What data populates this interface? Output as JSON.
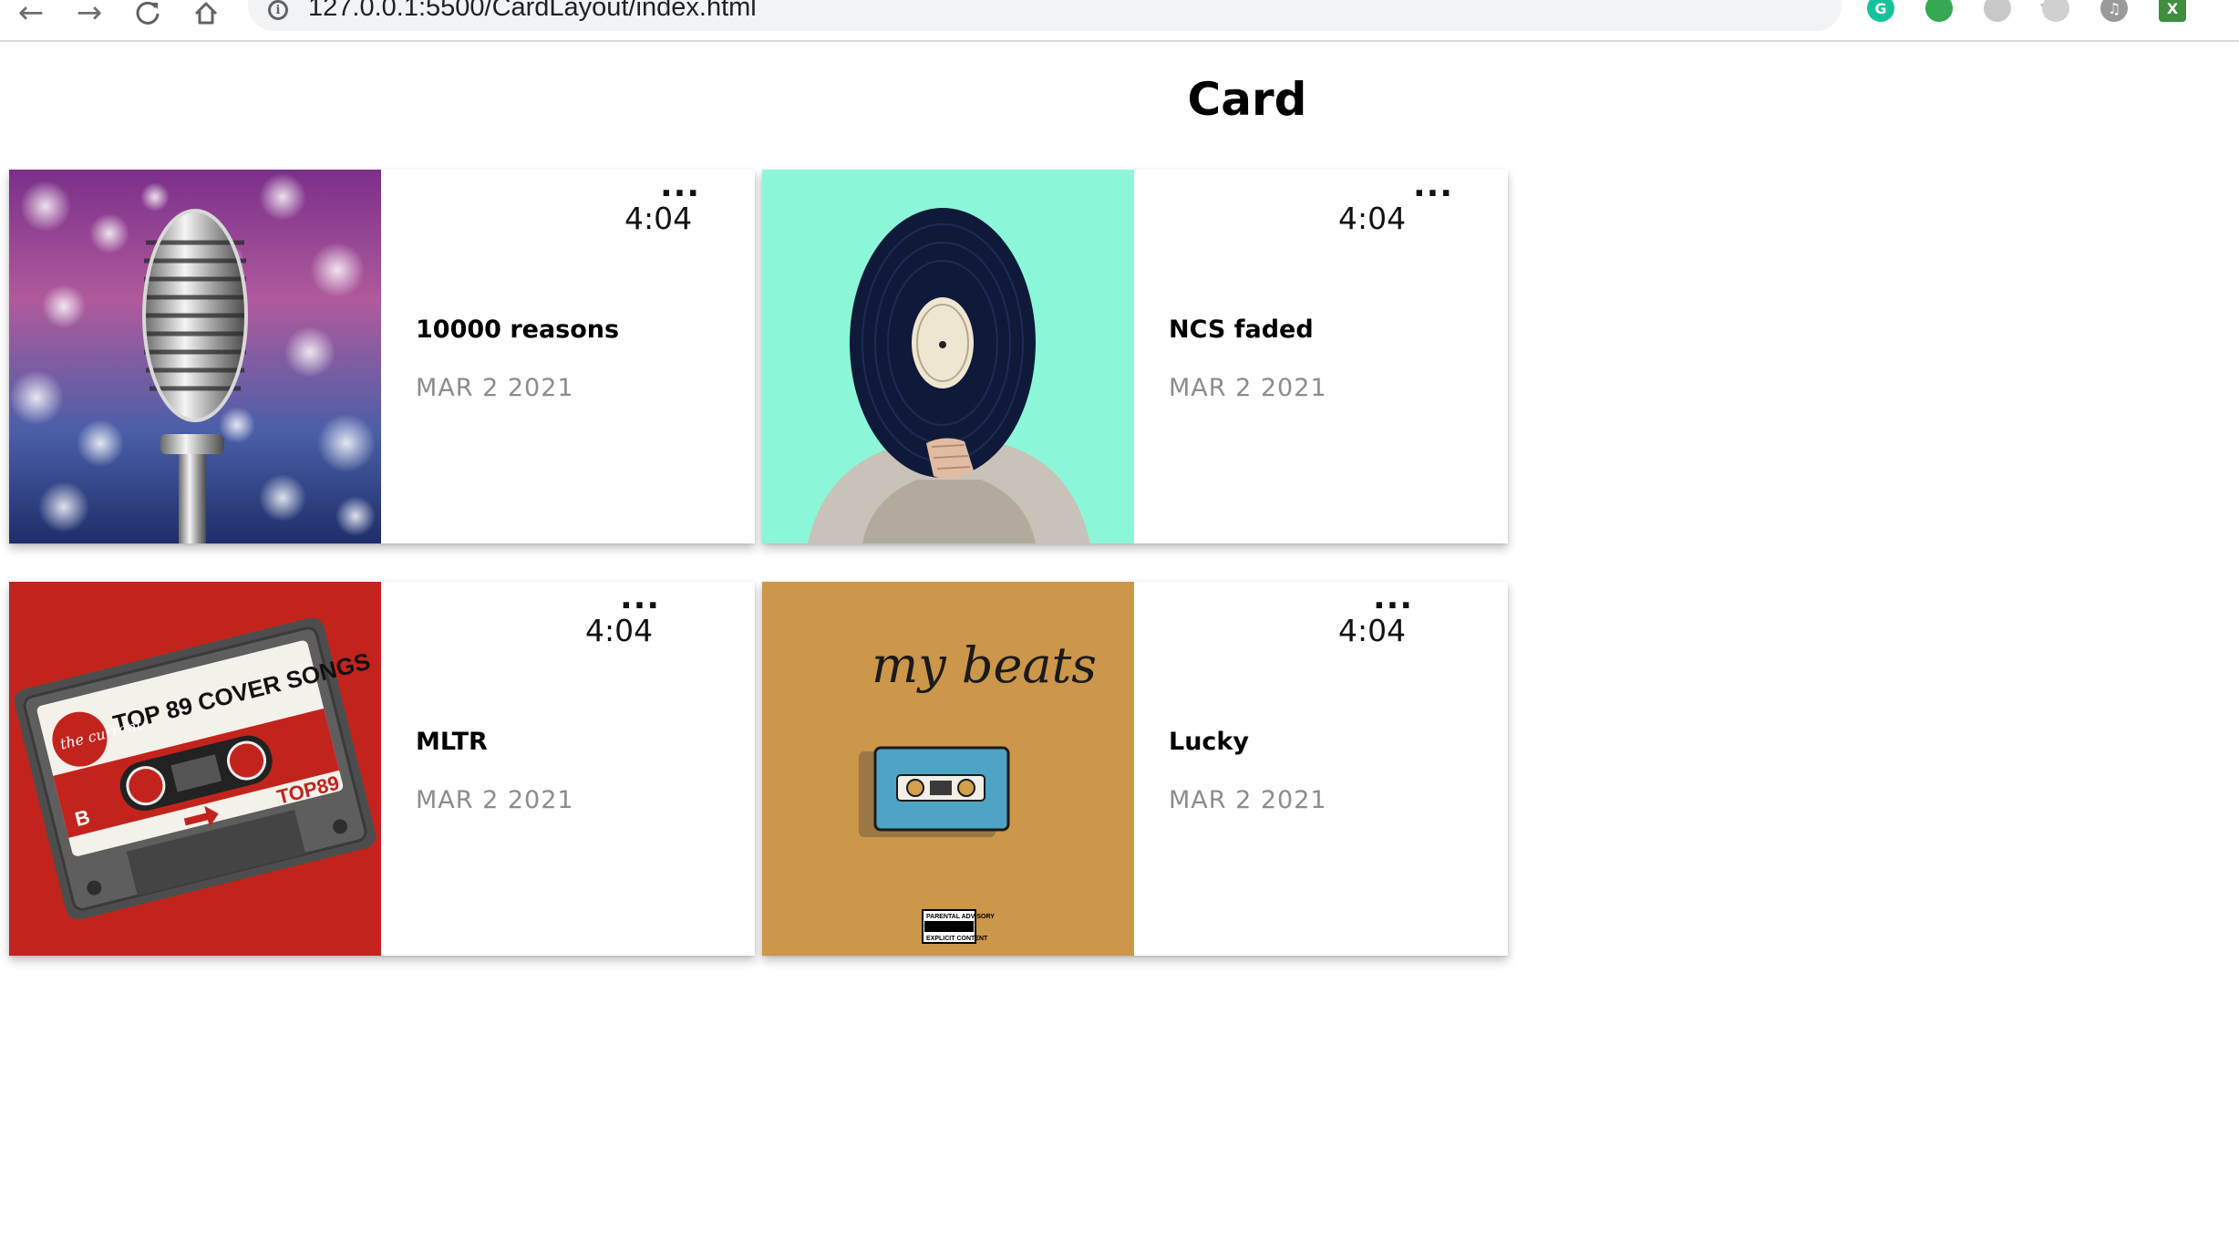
{
  "browser": {
    "url": "127.0.0.1:5500/CardLayout/index.html",
    "extensions": [
      {
        "name": "grammarly-extension-icon",
        "color": "#15c39a",
        "glyph": "G"
      },
      {
        "name": "green-chat-extension-icon",
        "color": "#34a853",
        "glyph": ""
      },
      {
        "name": "react-extension-icon",
        "color": "#c8c8c8",
        "glyph": ""
      },
      {
        "name": "target-extension-icon",
        "color": "#d0d0d0",
        "glyph": ""
      },
      {
        "name": "music-extension-icon",
        "color": "#9a9a9a",
        "glyph": "♫"
      },
      {
        "name": "x-extension-icon",
        "color": "#3e8e3e",
        "glyph": "X"
      }
    ]
  },
  "page": {
    "title": "Card"
  },
  "cards": [
    {
      "title": "10000 reasons",
      "date": "MAR 2 2021",
      "duration": "4:04",
      "more": "...",
      "cover": "microphone-cover-image"
    },
    {
      "title": "NCS faded",
      "date": "MAR 2 2021",
      "duration": "4:04",
      "more": "...",
      "cover": "vinyl-record-cover-image"
    },
    {
      "title": "MLTR",
      "date": "MAR 2 2021",
      "duration": "4:04",
      "more": "...",
      "cover": "cassette-top-89-cover-image"
    },
    {
      "title": "Lucky",
      "date": "MAR 2 2021",
      "duration": "4:04",
      "more": "...",
      "cover": "my-beats-cover-image"
    }
  ],
  "covers": {
    "cassette_label": "TOP 89 COVER SONGS",
    "cassette_brand": "the current",
    "cassette_side": "B",
    "cassette_logo": "TOP89",
    "my_beats_text": "my beats",
    "advisory_text": "PARENTAL ADVISORY",
    "advisory_sub": "EXPLICIT CONTENT"
  }
}
